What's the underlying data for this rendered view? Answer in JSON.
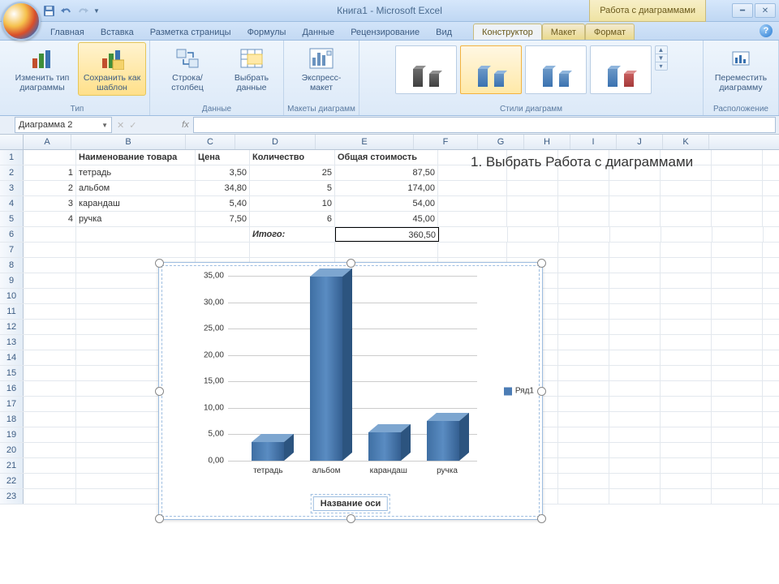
{
  "title": {
    "doc": "Книга1",
    "app": "Microsoft Excel",
    "context": "Работа с диаграммами"
  },
  "tabs": {
    "main": "Главная",
    "insert": "Вставка",
    "layout": "Разметка страницы",
    "formulas": "Формулы",
    "data": "Данные",
    "review": "Рецензирование",
    "view": "Вид",
    "design": "Конструктор",
    "chartlayout": "Макет",
    "format": "Формат"
  },
  "ribbon": {
    "type": {
      "change": "Изменить тип диаграммы",
      "save": "Сохранить как шаблон",
      "label": "Тип"
    },
    "data": {
      "switch": "Строка/столбец",
      "select": "Выбрать данные",
      "label": "Данные"
    },
    "layouts": {
      "quick": "Экспресс-макет",
      "label": "Макеты диаграмм"
    },
    "styles": {
      "label": "Стили диаграмм"
    },
    "location": {
      "move": "Переместить диаграмму",
      "label": "Расположение"
    }
  },
  "namebox": "Диаграмма 2",
  "fx": "fx",
  "columns": [
    "A",
    "B",
    "C",
    "D",
    "E",
    "F",
    "G",
    "H",
    "I",
    "J",
    "K"
  ],
  "headers": {
    "b": "Наименование товара",
    "c": "Цена",
    "d": "Количество",
    "e": "Общая стоимость"
  },
  "rows": [
    {
      "n": "1",
      "a": "1",
      "b": "тетрадь",
      "c": "3,50",
      "d": "25",
      "e": "87,50"
    },
    {
      "n": "2",
      "a": "2",
      "b": "альбом",
      "c": "34,80",
      "d": "5",
      "e": "174,00"
    },
    {
      "n": "3",
      "a": "3",
      "b": "карандаш",
      "c": "5,40",
      "d": "10",
      "e": "54,00"
    },
    {
      "n": "4",
      "a": "4",
      "b": "ручка",
      "c": "7,50",
      "d": "6",
      "e": "45,00"
    }
  ],
  "total": {
    "label": "Итого:",
    "value": "360,50"
  },
  "annotation": "1. Выбрать Работа с диаграммами",
  "chart": {
    "legend": "Ряд1",
    "axis_title": "Название оси"
  },
  "chart_data": {
    "type": "bar",
    "categories": [
      "тетрадь",
      "альбом",
      "карандаш",
      "ручка"
    ],
    "values": [
      3.5,
      34.8,
      5.4,
      7.5
    ],
    "series": [
      {
        "name": "Ряд1",
        "values": [
          3.5,
          34.8,
          5.4,
          7.5
        ]
      }
    ],
    "ylim": [
      0,
      35
    ],
    "yticks": [
      "0,00",
      "5,00",
      "10,00",
      "15,00",
      "20,00",
      "25,00",
      "30,00",
      "35,00"
    ],
    "xlabel": "Название оси",
    "ylabel": "",
    "title": ""
  }
}
